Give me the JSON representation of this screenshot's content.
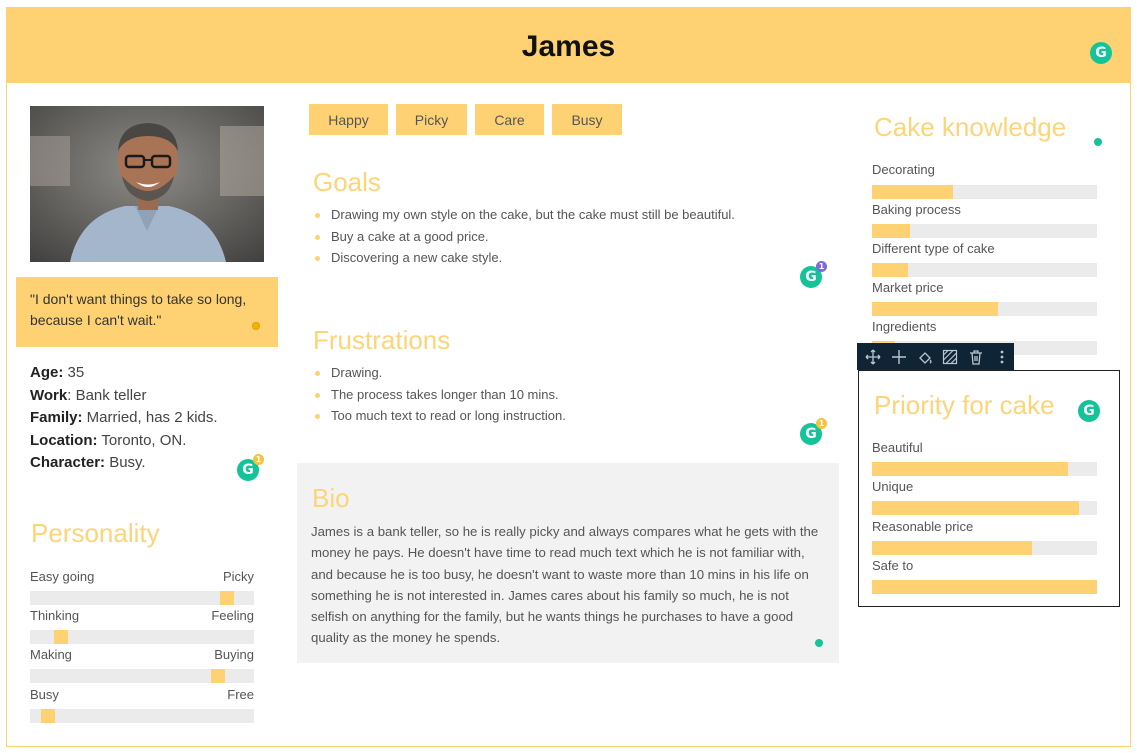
{
  "header": {
    "title": "James"
  },
  "quote": "\"I don't want things to take so long, because I can't wait.\"",
  "info": [
    {
      "label": "Age:",
      "value": " 35"
    },
    {
      "label": "Work",
      "value": ": Bank teller"
    },
    {
      "label": "Family:",
      "value": " Married, has 2 kids."
    },
    {
      "label": "Location:",
      "value": " Toronto, ON."
    },
    {
      "label": "Character:",
      "value": " Busy."
    }
  ],
  "personality": {
    "title": "Personality",
    "scales": [
      {
        "left": "Easy going",
        "right": "Picky",
        "position": 0.88
      },
      {
        "left": "Thinking",
        "right": "Feeling",
        "position": 0.14
      },
      {
        "left": "Making",
        "right": "Buying",
        "position": 0.84
      },
      {
        "left": "Busy",
        "right": "Free",
        "position": 0.08
      }
    ]
  },
  "tags": [
    "Happy",
    "Picky",
    "Care",
    "Busy"
  ],
  "goals": {
    "title": "Goals",
    "items": [
      "Drawing my own style on the cake, but the cake must still be beautiful.",
      "Buy a cake at a good price.",
      "Discovering a new cake style."
    ]
  },
  "frustrations": {
    "title": "Frustrations",
    "items": [
      "Drawing.",
      "The process takes longer than 10 mins.",
      "Too much text to read or long instruction."
    ]
  },
  "bio": {
    "title": "Bio",
    "text": "James is a bank teller, so he is really picky and always compares what he gets with the money he pays. He doesn't have time to read much text which he is not familiar with, and because he is too busy, he doesn't want to waste more than 10 mins in his life on something he is not interested in. James cares about his family so much, he is not selfish on anything for the family, but he wants things he purchases to have a good quality as the money he spends."
  },
  "cake_knowledge": {
    "title": "Cake knowledge",
    "items": [
      {
        "label": "Decorating",
        "value": 0.36
      },
      {
        "label": "Baking process",
        "value": 0.17
      },
      {
        "label": "Different type of cake",
        "value": 0.16
      },
      {
        "label": "Market price",
        "value": 0.56
      },
      {
        "label": "Ingredients",
        "value": 0.1
      }
    ]
  },
  "priority": {
    "title": "Priority for cake",
    "items": [
      {
        "label": "Beautiful",
        "value": 0.87
      },
      {
        "label": "Unique",
        "value": 0.92
      },
      {
        "label": "Reasonable price",
        "value": 0.71
      },
      {
        "label": "Safe to",
        "value": 1.0
      }
    ]
  },
  "grammarly": {
    "glyph": "G",
    "badges": [
      "1",
      "1",
      "1"
    ]
  },
  "toolbar": {
    "tools": [
      "move-icon",
      "add-icon",
      "fill-icon",
      "pattern-icon",
      "delete-icon",
      "more-icon"
    ]
  },
  "colors": {
    "accent": "#fed273",
    "track": "#ebebeb",
    "grammarly": "#15c39a"
  }
}
